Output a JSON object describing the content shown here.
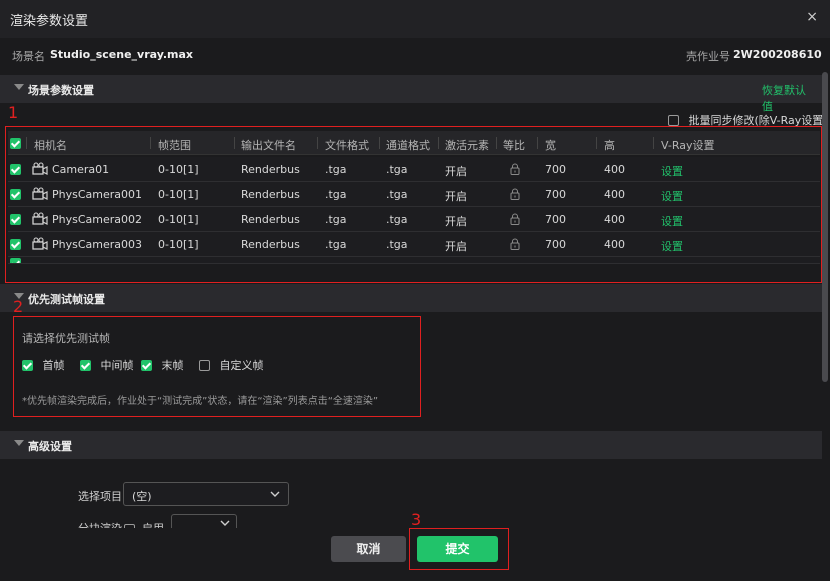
{
  "dialog": {
    "title": "渲染参数设置",
    "close": "×"
  },
  "info": {
    "scene_label": "场景名",
    "scene_value": "Studio_scene_vray.max",
    "job_label": "壳作业号",
    "job_value": "2W200208610"
  },
  "scene_section": {
    "title": "场景参数设置",
    "reset": "恢复默认值",
    "batch_label": "批量同步修改(除V-Ray设置)"
  },
  "table": {
    "headers": [
      "相机名",
      "帧范围",
      "输出文件名",
      "文件格式",
      "通道格式",
      "激活元素",
      "等比",
      "宽",
      "高",
      "V-Ray设置"
    ],
    "rows": [
      {
        "camera": "Camera01",
        "frames": "0-10[1]",
        "output": "Renderbus",
        "format": ".tga",
        "channel": ".tga",
        "active": "开启",
        "width": "700",
        "height": "400",
        "vray": "设置"
      },
      {
        "camera": "PhysCamera001",
        "frames": "0-10[1]",
        "output": "Renderbus",
        "format": ".tga",
        "channel": ".tga",
        "active": "开启",
        "width": "700",
        "height": "400",
        "vray": "设置"
      },
      {
        "camera": "PhysCamera002",
        "frames": "0-10[1]",
        "output": "Renderbus",
        "format": ".tga",
        "channel": ".tga",
        "active": "开启",
        "width": "700",
        "height": "400",
        "vray": "设置"
      },
      {
        "camera": "PhysCamera003",
        "frames": "0-10[1]",
        "output": "Renderbus",
        "format": ".tga",
        "channel": ".tga",
        "active": "开启",
        "width": "700",
        "height": "400",
        "vray": "设置"
      }
    ]
  },
  "priority_section": {
    "title": "优先测试帧设置",
    "prompt": "请选择优先测试帧",
    "options": [
      "首帧",
      "中间帧",
      "末帧",
      "自定义帧"
    ],
    "note": "*优先帧渲染完成后，作业处于“测试完成”状态，请在“渲染”列表点击“全速渲染”"
  },
  "advanced_section": {
    "title": "高级设置",
    "select_label": "选择项目",
    "select_value": "(空)",
    "partial_label": "分块渲染",
    "enable_label": "启用"
  },
  "buttons": {
    "cancel": "取消",
    "submit": "提交"
  },
  "annotations": [
    "1",
    "2",
    "3"
  ],
  "colors": {
    "accent": "#21c36a",
    "highlight": "#e02020",
    "background": "#1b1b1d"
  }
}
